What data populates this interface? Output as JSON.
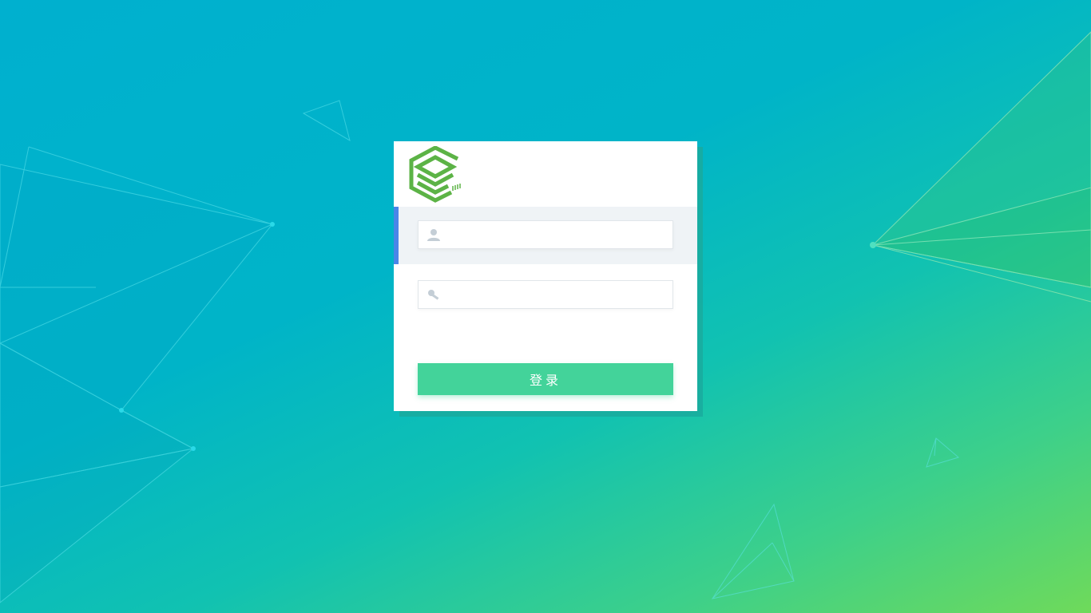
{
  "login": {
    "username": {
      "value": "",
      "placeholder": "",
      "icon": "user-icon"
    },
    "password": {
      "value": "",
      "placeholder": "",
      "icon": "key-icon"
    },
    "submit_label": "登录"
  },
  "logo": {
    "icon": "stacked-layers-hexagon-logo"
  },
  "colors": {
    "primary_button": "#43d39a",
    "active_indicator": "#4a86e8",
    "logo_green": "#5cb346",
    "background_start": "#00b0cf",
    "background_end": "#6fda5a"
  }
}
